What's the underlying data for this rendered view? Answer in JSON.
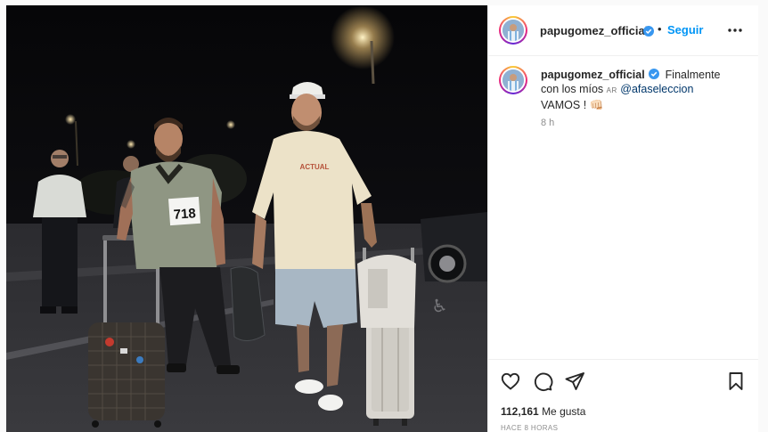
{
  "post": {
    "username": "papugomez_official",
    "follow_label": "Seguir",
    "separator": "•",
    "caption": {
      "username": "papugomez_official",
      "text_line1": "Finalmente",
      "text_line2": "con los míos",
      "flag_code": "AR",
      "mention": "@afaseleccion",
      "text_line3": "VAMOS !",
      "emoji": "👊🏻"
    },
    "time_ago": "8 h",
    "likes_count": "112,161",
    "likes_label": "Me gusta",
    "posted_ago": "HACE 8 HORAS"
  },
  "photo": {
    "bib_number": "718",
    "shirt_print": "ACTUAL"
  },
  "icons": {
    "verified": "verified-badge-icon",
    "more": "more-options-icon",
    "like": "heart-icon",
    "comment": "comment-icon",
    "share": "send-icon",
    "save": "bookmark-icon"
  },
  "colors": {
    "accent": "#0095f6",
    "verified": "#3897f0",
    "text": "#262626",
    "muted": "#8e8e8e"
  }
}
